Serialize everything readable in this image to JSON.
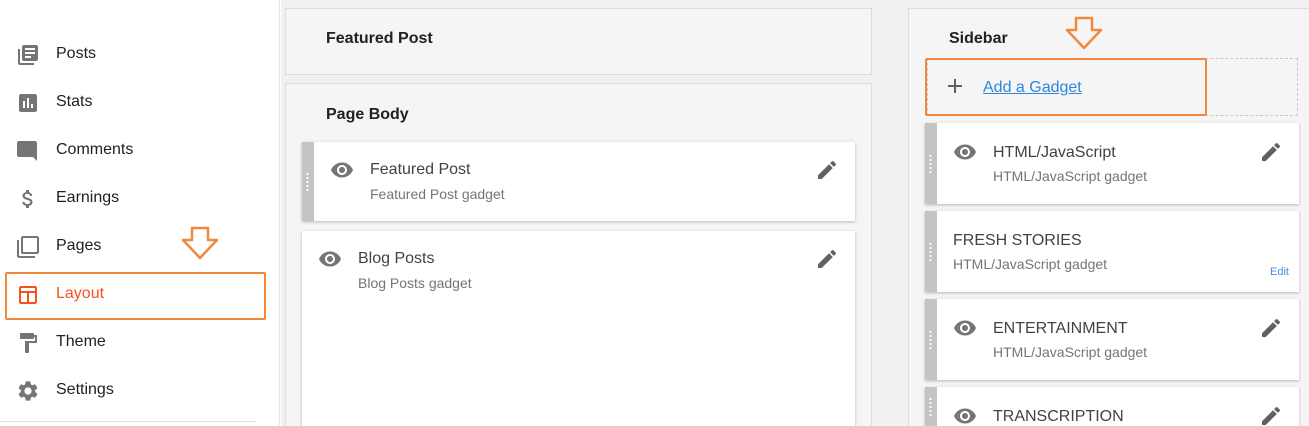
{
  "nav": {
    "items": [
      {
        "label": "Posts",
        "icon": "posts-icon"
      },
      {
        "label": "Stats",
        "icon": "stats-icon"
      },
      {
        "label": "Comments",
        "icon": "comments-icon"
      },
      {
        "label": "Earnings",
        "icon": "dollar-icon"
      },
      {
        "label": "Pages",
        "icon": "pages-icon"
      },
      {
        "label": "Layout",
        "icon": "layout-icon",
        "active": true
      },
      {
        "label": "Theme",
        "icon": "paint-roller-icon"
      },
      {
        "label": "Settings",
        "icon": "gear-icon"
      }
    ]
  },
  "sections": {
    "featured_post": {
      "title": "Featured Post"
    },
    "page_body": {
      "title": "Page Body",
      "gadgets": [
        {
          "title": "Featured Post",
          "subtitle": "Featured Post gadget"
        },
        {
          "title": "Blog Posts",
          "subtitle": "Blog Posts gadget"
        }
      ]
    },
    "sidebar": {
      "title": "Sidebar",
      "add_gadget_label": "Add a Gadget",
      "gadgets": [
        {
          "title": "HTML/JavaScript",
          "subtitle": "HTML/JavaScript gadget"
        },
        {
          "title": "FRESH STORIES",
          "subtitle": "HTML/JavaScript gadget",
          "edit_label": "Edit"
        },
        {
          "title": "ENTERTAINMENT",
          "subtitle": "HTML/JavaScript gadget"
        },
        {
          "title": "TRANSCRIPTION",
          "subtitle": ""
        }
      ]
    }
  },
  "colors": {
    "accent": "#f4511e",
    "highlight": "#f0883e",
    "link": "#2e86de",
    "icon_gray": "#757575"
  }
}
